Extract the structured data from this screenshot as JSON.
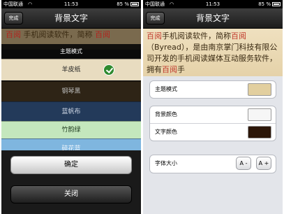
{
  "status_bar": {
    "carrier": "中国联通",
    "wifi_icon": "wifi-icon",
    "time": "11:53",
    "battery": "85 %"
  },
  "left_screen": {
    "navbar": {
      "done": "完成",
      "title": "背景文字"
    },
    "reading_text": {
      "part1": "百阅",
      "part2": " 手机阅读软件，简称 ",
      "part3": "百阅"
    },
    "sheet": {
      "title": "主题模式",
      "options": [
        {
          "label": "羊皮纸",
          "selected": true,
          "color": "#e8dcc0",
          "text_color": "#222222"
        },
        {
          "label": "钢琴黑",
          "selected": false,
          "color": "#2e2416",
          "text_color": "#bbbbbb"
        },
        {
          "label": "蓝帆布",
          "selected": false,
          "color": "#233a5a",
          "text_color": "#cfd8e6"
        },
        {
          "label": "竹韵绿",
          "selected": false,
          "color": "#c4e7bd",
          "text_color": "#1e3a1e"
        },
        {
          "label": "碎花蓝",
          "selected": false,
          "color": "#7fb6df",
          "text_color": "#f0f6fb"
        }
      ],
      "confirm": "确定",
      "close": "关闭"
    }
  },
  "right_screen": {
    "navbar": {
      "done": "完成",
      "title": "背景文字"
    },
    "reading_text": {
      "red1": "百阅",
      "seg1": "手机阅读软件，简称",
      "red2": "百阅",
      "seg2": "（Byread），是由南京掌门科技有限公司开发的手机阅读",
      "seg3": "媒体互动服务软件，拥有",
      "red3": "百阅",
      "seg4": "手"
    },
    "settings": {
      "theme_label": "主题模式",
      "theme_color": "#e2cf9f",
      "bg_color_label": "背景颜色",
      "bg_color": "#f6f6f6",
      "text_color_label": "文字颜色",
      "text_color": "#2c1608",
      "font_size_label": "字体大小",
      "font_decrease": "A -",
      "font_increase": "A +"
    }
  }
}
